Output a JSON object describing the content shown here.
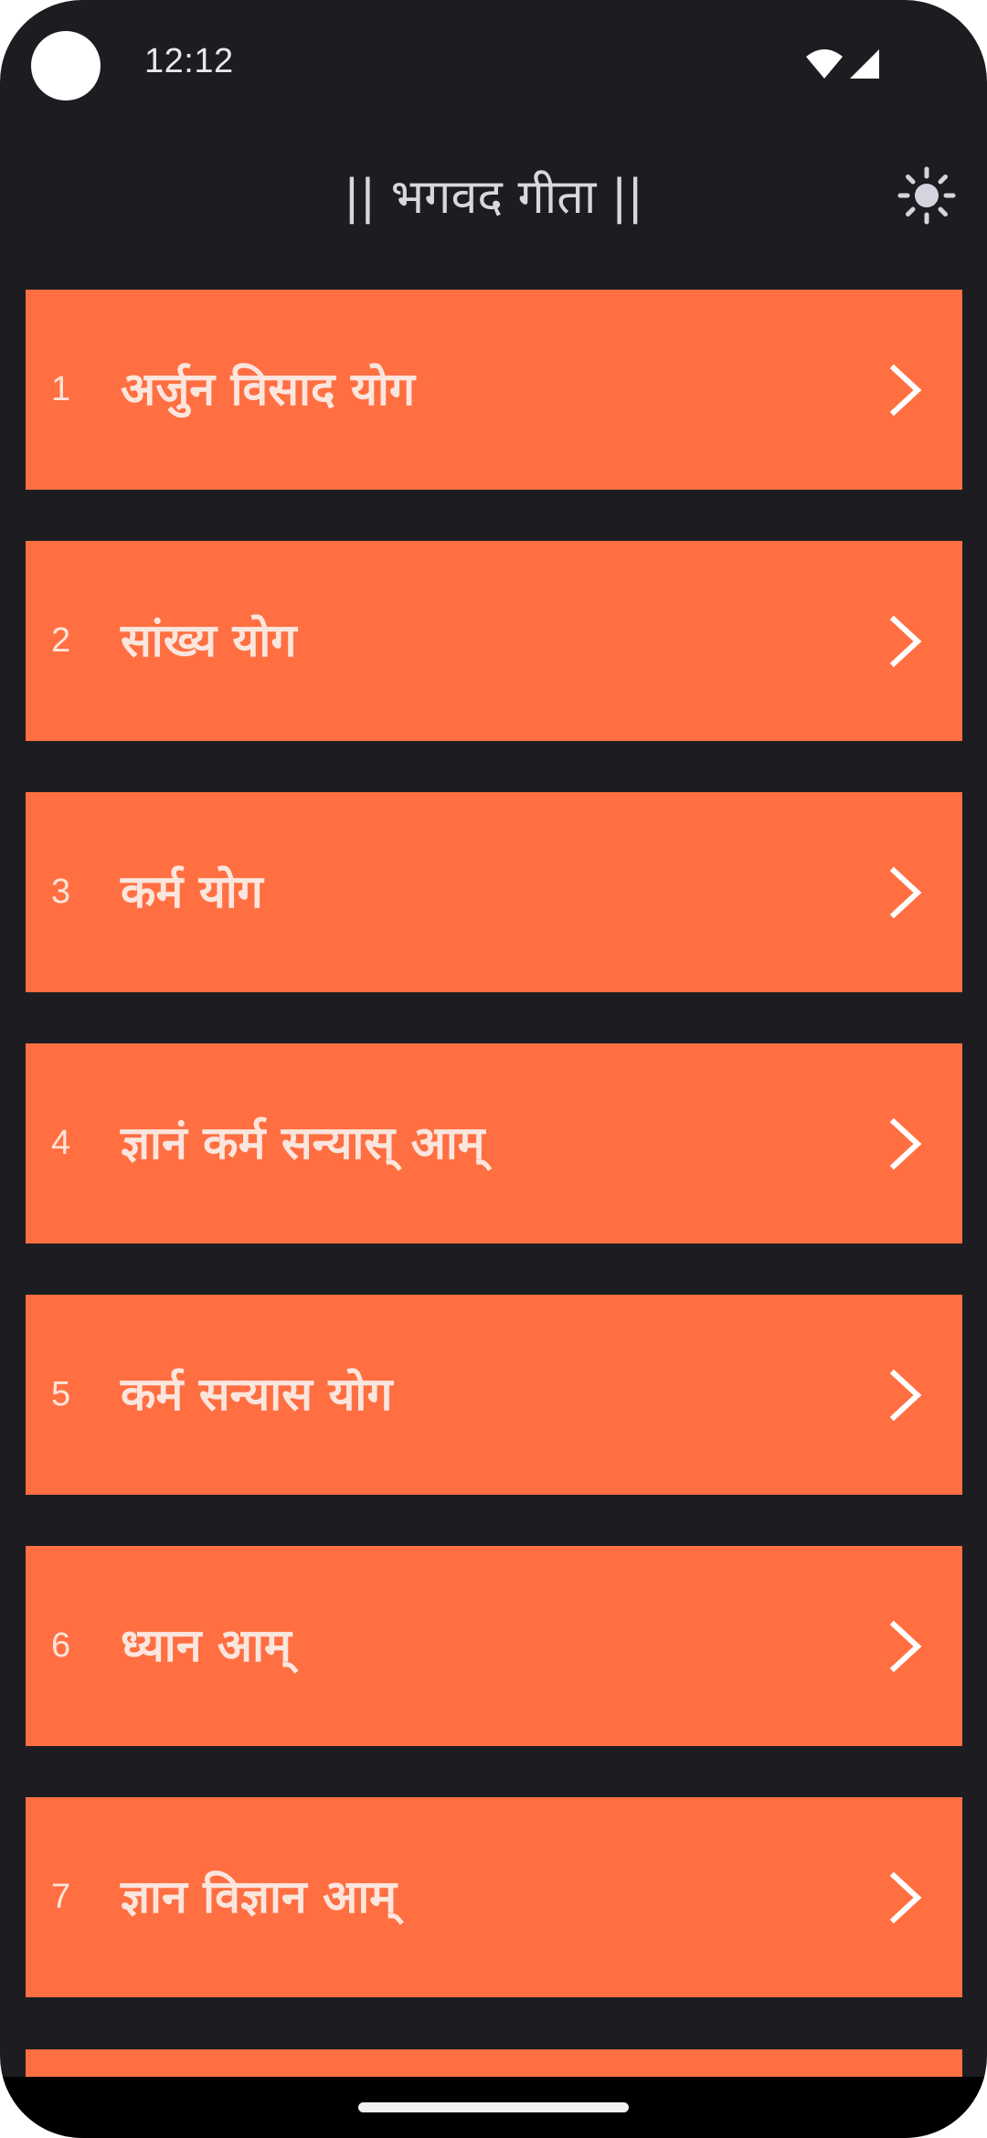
{
  "status_bar": {
    "time": "12:12",
    "icons": [
      "camera-dot",
      "wifi-icon",
      "signal-icon"
    ]
  },
  "app_bar": {
    "title": "|| भगवद गीता ||",
    "theme_icon": "sun-icon"
  },
  "colors": {
    "background": "#1d1d21",
    "card": "#ff6f42",
    "card_text": "#fbe6de",
    "title_text": "#d8d8dc"
  },
  "chapters": [
    {
      "number": "1",
      "name": "अर्जुन विसाद योग"
    },
    {
      "number": "2",
      "name": "सांख्य योग"
    },
    {
      "number": "3",
      "name": "कर्म योग"
    },
    {
      "number": "4",
      "name": "ज्ञानं कर्म सन्यास् आम्"
    },
    {
      "number": "5",
      "name": "कर्म सन्यास योग"
    },
    {
      "number": "6",
      "name": "ध्यान आम्"
    },
    {
      "number": "7",
      "name": "ज्ञान विज्ञान आम्"
    }
  ]
}
